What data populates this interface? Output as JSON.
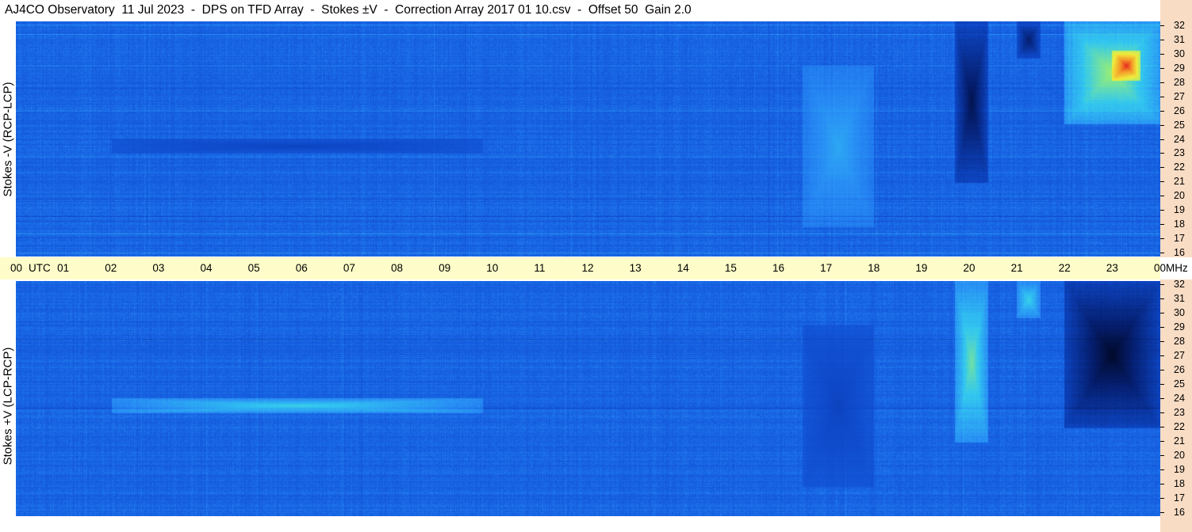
{
  "title": "AJ4CO Observatory  11 Jul 2023  -  DPS on TFD Array  -  Stokes ±V  -  Correction Array 2017 01 10.csv  -  Offset 50  Gain 2.0",
  "colors": {
    "background": "#1658d8",
    "axis_band": "#fefdc9",
    "freq_strip": "#f8dcc4"
  },
  "chart_data": [
    {
      "type": "heatmap",
      "panel": "top",
      "ylabel": "Stokes -V (RCP-LCP)",
      "x_unit": "UTC",
      "xticks": [
        "00",
        "01",
        "02",
        "03",
        "04",
        "05",
        "06",
        "07",
        "08",
        "09",
        "10",
        "11",
        "12",
        "13",
        "14",
        "15",
        "16",
        "17",
        "18",
        "19",
        "20",
        "21",
        "22",
        "23",
        "00"
      ],
      "xlim": [
        0,
        24
      ],
      "y_unit": "MHz",
      "yticks": [
        "16",
        "17",
        "18",
        "19",
        "20",
        "21",
        "22",
        "23",
        "24",
        "25",
        "26",
        "27",
        "28",
        "29",
        "30",
        "31",
        "32"
      ],
      "ylim": [
        16,
        32
      ],
      "features": [
        {
          "kind": "dark",
          "t": [
            2,
            9.8
          ],
          "f": [
            23,
            24
          ],
          "level": 0.3
        },
        {
          "kind": "dark",
          "t": [
            19.7,
            20.4
          ],
          "f": [
            21,
            32
          ],
          "level": 0.1
        },
        {
          "kind": "dark",
          "t": [
            21.0,
            21.5
          ],
          "f": [
            29.5,
            32
          ],
          "level": 0.15
        },
        {
          "kind": "bright",
          "t": [
            22.0,
            24.0
          ],
          "f": [
            25,
            32
          ],
          "level": 0.8
        },
        {
          "kind": "bright",
          "t": [
            23.0,
            23.6
          ],
          "f": [
            28,
            30
          ],
          "level": 1.0
        },
        {
          "kind": "bright",
          "t": [
            16.5,
            18.0
          ],
          "f": [
            18,
            29
          ],
          "level": 0.62
        }
      ]
    },
    {
      "type": "heatmap",
      "panel": "bottom",
      "ylabel": "Stokes +V (LCP-RCP)",
      "x_unit": "UTC",
      "xticks": [
        "00",
        "01",
        "02",
        "03",
        "04",
        "05",
        "06",
        "07",
        "08",
        "09",
        "10",
        "11",
        "12",
        "13",
        "14",
        "15",
        "16",
        "17",
        "18",
        "19",
        "20",
        "21",
        "22",
        "23",
        "00"
      ],
      "xlim": [
        0,
        24
      ],
      "y_unit": "MHz",
      "yticks": [
        "16",
        "17",
        "18",
        "19",
        "20",
        "21",
        "22",
        "23",
        "24",
        "25",
        "26",
        "27",
        "28",
        "29",
        "30",
        "31",
        "32"
      ],
      "ylim": [
        16,
        32
      ],
      "features": [
        {
          "kind": "bright",
          "t": [
            2,
            9.8
          ],
          "f": [
            23,
            24
          ],
          "level": 0.7
        },
        {
          "kind": "bright",
          "t": [
            19.7,
            20.4
          ],
          "f": [
            21,
            32
          ],
          "level": 0.75
        },
        {
          "kind": "bright",
          "t": [
            21.0,
            21.5
          ],
          "f": [
            29.5,
            32
          ],
          "level": 0.7
        },
        {
          "kind": "dark",
          "t": [
            22.0,
            24.0
          ],
          "f": [
            22,
            32
          ],
          "level": 0.05
        },
        {
          "kind": "dark",
          "t": [
            16.5,
            18.0
          ],
          "f": [
            18,
            29
          ],
          "level": 0.3
        }
      ]
    }
  ]
}
